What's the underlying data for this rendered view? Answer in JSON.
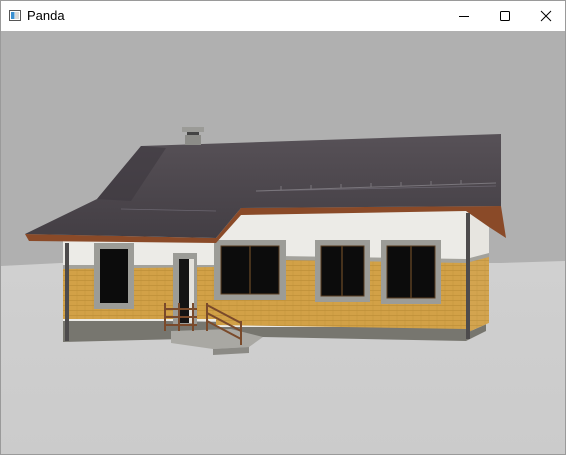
{
  "window": {
    "title": "Panda"
  },
  "title_bar_buttons": {
    "minimize_icon": "minimize-icon",
    "maximize_icon": "maximize-icon",
    "close_icon": "close-icon"
  },
  "scene": {
    "background_color": "#b0b0b0",
    "ground_color": "#cfcfcf",
    "roof_color": "#4c474d",
    "wall_color": "#d2a147",
    "trim_color": "#9a9a9a",
    "render_upper_color": "#ecebe7"
  }
}
